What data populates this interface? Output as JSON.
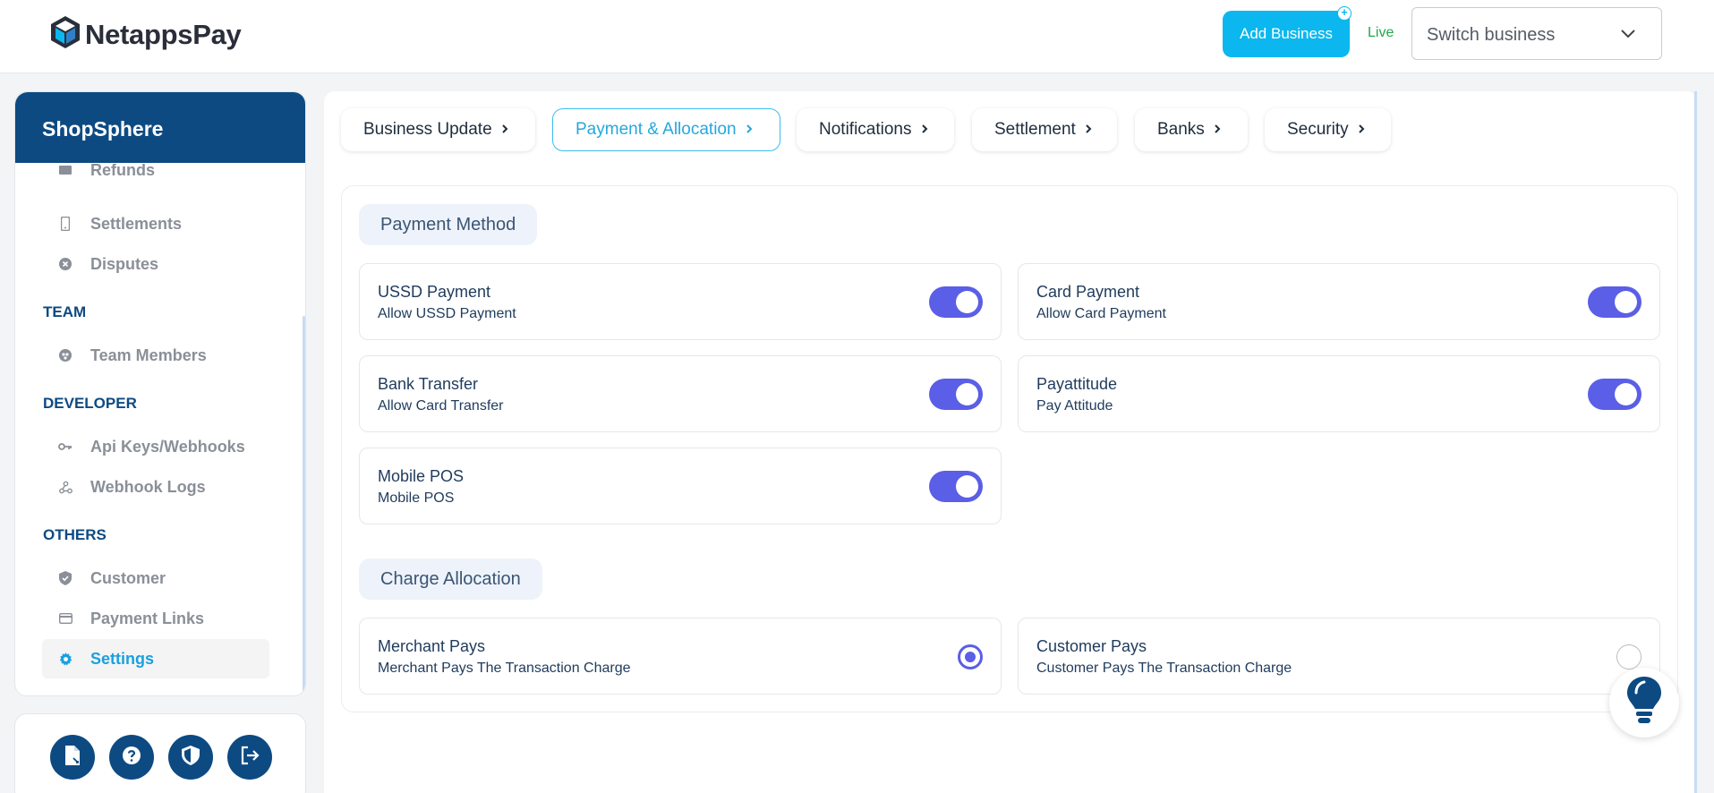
{
  "header": {
    "logo_text": "NetappsPay",
    "add_business_label": "Add Business",
    "mode_label": "Live",
    "switch_business_placeholder": "Switch business"
  },
  "sidebar": {
    "business_name": "ShopSphere",
    "items_top": [
      {
        "label": "Refunds",
        "icon": "receipt-icon"
      },
      {
        "label": "Settlements",
        "icon": "phone-icon"
      },
      {
        "label": "Disputes",
        "icon": "close-circle-icon"
      }
    ],
    "sections": [
      {
        "title": "TEAM",
        "items": [
          {
            "label": "Team Members",
            "icon": "team-icon"
          }
        ]
      },
      {
        "title": "DEVELOPER",
        "items": [
          {
            "label": "Api Keys/Webhooks",
            "icon": "key-icon"
          },
          {
            "label": "Webhook Logs",
            "icon": "webhook-icon"
          }
        ]
      },
      {
        "title": "OTHERS",
        "items": [
          {
            "label": "Customer",
            "icon": "shield-check-icon"
          },
          {
            "label": "Payment Links",
            "icon": "card-icon"
          },
          {
            "label": "Settings",
            "icon": "gear-icon",
            "active": true
          }
        ]
      }
    ],
    "bottom_buttons": [
      "document-icon",
      "help-icon",
      "security-icon",
      "logout-icon"
    ]
  },
  "tabs": [
    {
      "label": "Business Update"
    },
    {
      "label": "Payment & Allocation",
      "active": true
    },
    {
      "label": "Notifications"
    },
    {
      "label": "Settlement"
    },
    {
      "label": "Banks"
    },
    {
      "label": "Security"
    }
  ],
  "payment_method": {
    "title": "Payment Method",
    "methods": [
      {
        "title": "USSD Payment",
        "subtitle": "Allow USSD Payment",
        "enabled": true
      },
      {
        "title": "Card Payment",
        "subtitle": "Allow Card Payment",
        "enabled": true
      },
      {
        "title": "Bank Transfer",
        "subtitle": "Allow Card Transfer",
        "enabled": true
      },
      {
        "title": "Payattitude",
        "subtitle": "Pay Attitude",
        "enabled": true
      },
      {
        "title": "Mobile POS",
        "subtitle": "Mobile POS",
        "enabled": true
      }
    ]
  },
  "charge_allocation": {
    "title": "Charge Allocation",
    "options": [
      {
        "title": "Merchant Pays",
        "subtitle": "Merchant Pays The Transaction Charge",
        "selected": true
      },
      {
        "title": "Customer Pays",
        "subtitle": "Customer Pays The Transaction Charge",
        "selected": false
      }
    ]
  },
  "colors": {
    "brand_navy": "#0d4a82",
    "accent_cyan": "#0bb7ee",
    "toggle_purple": "#5b5ee6",
    "live_green": "#22a84a"
  }
}
